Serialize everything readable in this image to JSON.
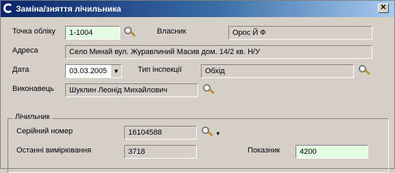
{
  "window": {
    "title": "Заміна/зняття лічильника",
    "close": "✕"
  },
  "form": {
    "account_label": "Точка обліку",
    "account_value": "1-1004",
    "owner_label": "Власник",
    "owner_value": "Орос Й Ф",
    "address_label": "Адреса",
    "address_value": "Село Минай вул. Журавлиний Масив дом. 14/2 кв. Н/У",
    "date_label": "Дата",
    "date_value": "03.03.2005",
    "inspection_label": "Тип інспекції",
    "inspection_value": "Обхід",
    "executor_label": "Виконавець",
    "executor_value": "Шуклин Леонід Михайлович"
  },
  "meter": {
    "group_title": "Лічильник",
    "serial_label": "Серійний номер",
    "serial_value": "16104588",
    "last_label": "Останні вимірювання",
    "last_value": "3718",
    "reading_label": "Показник",
    "reading_value": "4200"
  },
  "colors": {
    "titlebar_start": "#0a246a",
    "editable_bg": "#e3fbe3",
    "window_bg": "#d4d0c8"
  }
}
